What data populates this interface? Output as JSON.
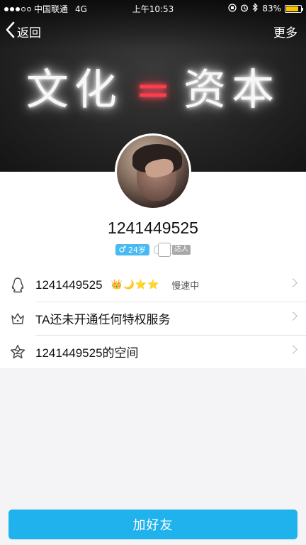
{
  "status_bar": {
    "carrier": "中国联通",
    "network": "4G",
    "time": "上午10:53",
    "battery_percent": "83%",
    "battery_level": 0.83
  },
  "nav": {
    "back_label": "返回",
    "more_label": "更多"
  },
  "hero": {
    "left_text": "文化",
    "right_text": "资本",
    "accent_color": "#ff3b4c"
  },
  "profile": {
    "uid": "1241449525",
    "age_label": "24岁",
    "daren_label": "达人"
  },
  "rows": [
    {
      "text": "1241449525",
      "status": "慢速中",
      "icon": "qq-penguin-icon"
    },
    {
      "text": "TA还未开通任何特权服务",
      "icon": "crown-outline-icon"
    },
    {
      "text": "1241449525的空间",
      "icon": "star-outline-icon"
    }
  ],
  "add_friend_label": "加好友",
  "colors": {
    "primary": "#20b2ec",
    "age_badge": "#49b9f2",
    "battery": "#f6c500"
  }
}
